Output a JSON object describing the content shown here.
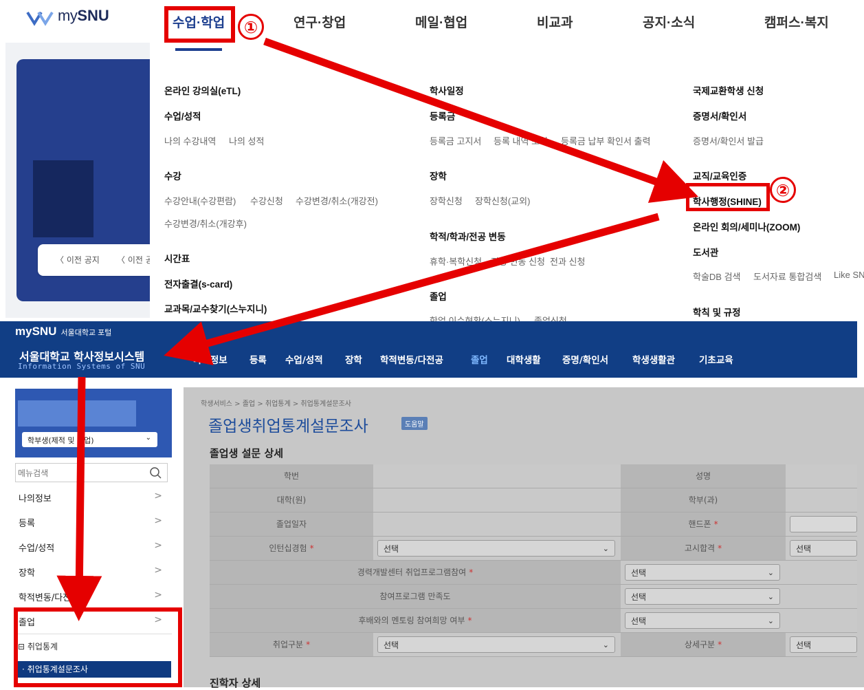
{
  "brand": {
    "my": "my",
    "snu": "SNU"
  },
  "top_nav": {
    "items": [
      "수업·학업",
      "연구·창업",
      "메일·협업",
      "비교과",
      "공지·소식",
      "캠퍼스·복지"
    ]
  },
  "left_card": {
    "prev1": "〈 이전 공지",
    "prev2": "〈 이전 공"
  },
  "mega_menu": {
    "col1": {
      "h1": "온라인 강의실(eTL)",
      "h2": "수업/성적",
      "l2": [
        "나의 수강내역",
        "나의 성적"
      ],
      "h3": "수강",
      "l3": [
        "수강안내(수강편람)",
        "수강신청",
        "수강변경/취소(개강전)"
      ],
      "l3b": "수강변경/취소(개강후)",
      "h4": "시간표",
      "h5": "전자출결(s-card)",
      "h6": "교과목/교수찾기(스누지니)"
    },
    "col2": {
      "h1": "학사일정",
      "h2": "등록금",
      "l2": [
        "등록금 고지서",
        "등록 내역 조회",
        "등록금 납부 확인서 출력"
      ],
      "h3": "장학",
      "l3": [
        "장학신청",
        "장학신청(교외)"
      ],
      "h4": "학적/학과/전공 변동",
      "l4": [
        "휴학·복학신청",
        "전공 변동 신청",
        "전과 신청"
      ],
      "h5": "졸업",
      "l5": [
        "학업 이수현황(스누지니)",
        "졸업신청"
      ]
    },
    "col3": {
      "h1": "국제교환학생 신청",
      "h2": "증명서/확인서",
      "l2": "증명서/확인서 발급",
      "h3": "교직/교육인증",
      "h4": "학사행정(SHINE)",
      "h5": "온라인 회의/세미나(ZOOM)",
      "h6": "도서관",
      "l6": [
        "학술DB 검색",
        "도서자료 통합검색",
        "Like SN"
      ],
      "h7": "학칙 및 규정"
    }
  },
  "portal": {
    "logo": "mySNU",
    "logo_sub": "서울대학교 포털",
    "title": "서울대학교 학사정보시스템",
    "subtitle": "Information Systems of SNU",
    "nav": [
      "나의정보",
      "등록",
      "수업/성적",
      "장학",
      "학적변동/다전공",
      "졸업",
      "대학생활",
      "증명/확인서",
      "학생생활관",
      "기초교육"
    ],
    "active_nav": "졸업"
  },
  "sidebar": {
    "select_value": "학부생(제적 및 졸업)",
    "search_placeholder": "메뉴검색",
    "items": [
      "나의정보",
      "등록",
      "수업/성적",
      "장학",
      "학적변동/다전공",
      "졸업"
    ],
    "sub1": "⊟ 취업통계",
    "sub2": "· 취업통계설문조사"
  },
  "content": {
    "breadcrumb": "학생서비스 > 졸업 > 취업통계 > 취업통계설문조사",
    "title": "졸업생취업통계설문조사",
    "help": "도움말",
    "section1": "졸업생 설문 상세",
    "section2": "진학자 상세",
    "labels": {
      "student_no": "학번",
      "name": "성명",
      "college": "대학(원)",
      "dept": "학부(과)",
      "grad_date": "졸업일자",
      "phone": "핸드폰",
      "intern": "인턴십경험",
      "exam": "고시합격",
      "career": "경력개발센터 취업프로그램참여",
      "satisfaction": "참여프로그램 만족도",
      "mentoring": "후배와의 멘토링 참여희망 여부",
      "emp_type": "취업구분",
      "detail_type": "상세구분"
    },
    "select_text": "선택",
    "required_mark": "*"
  },
  "annotations": {
    "n1": "①",
    "n2": "②"
  }
}
